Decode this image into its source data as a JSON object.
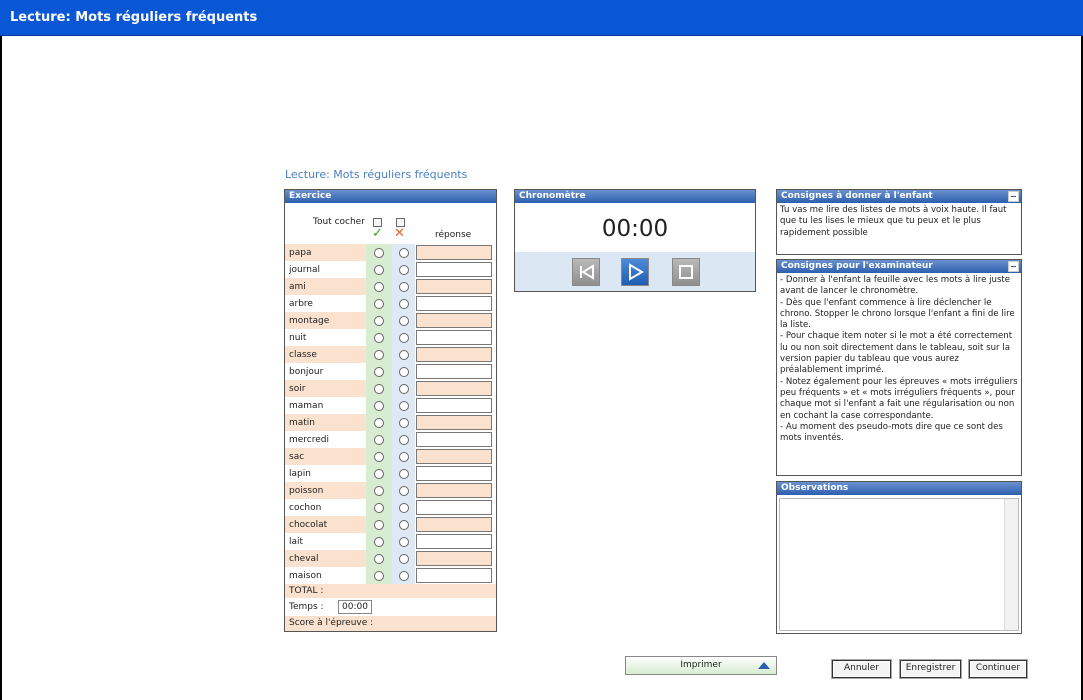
{
  "window": {
    "title": "Lecture: Mots réguliers fréquents"
  },
  "page": {
    "heading": "Lecture: Mots réguliers fréquents"
  },
  "exercise": {
    "header": "Exercice",
    "tout_cocher": "Tout cocher",
    "reponse_header": "réponse",
    "words": [
      "papa",
      "journal",
      "ami",
      "arbre",
      "montage",
      "nuit",
      "classe",
      "bonjour",
      "soir",
      "maman",
      "matin",
      "mercredi",
      "sac",
      "lapin",
      "poisson",
      "cochon",
      "chocolat",
      "lait",
      "cheval",
      "maison"
    ],
    "total_label": "TOTAL :",
    "temps_label": "Temps :",
    "temps_value": "00:00",
    "score_label": "Score à l'épreuve :"
  },
  "chrono": {
    "header": "Chronomètre",
    "time": "00:00"
  },
  "consignes_enfant": {
    "header": "Consignes à donner à l'enfant",
    "text": "Tu vas me lire des listes de mots à voix haute. Il faut que tu les lises le mieux que tu peux et le plus rapidement possible"
  },
  "consignes_exam": {
    "header": "Consignes pour l'examinateur",
    "lines": [
      "- Donner à l'enfant la feuille avec les mots à lire juste avant de lancer le chronomètre.",
      "- Dès que l'enfant commence à lire déclencher le chrono. Stopper le chrono lorsque l'enfant a fini de lire la liste.",
      "- Pour chaque item noter si le mot a été correctement lu ou non soit directement dans le tableau, soit sur la version papier du tableau que vous aurez préalablement imprimé.",
      "- Notez également pour les épreuves « mots irréguliers peu fréquents » et « mots irréguliers fréquents », pour chaque mot si l'enfant a fait une régularisation ou non en cochant la case correspondante.",
      "- Au moment des pseudo-mots dire que ce sont des mots inventés."
    ]
  },
  "observations": {
    "header": "Observations"
  },
  "buttons": {
    "imprimer": "Imprimer",
    "annuler": "Annuler",
    "enregistrer": "Enregistrer",
    "continuer": "Continuer"
  }
}
